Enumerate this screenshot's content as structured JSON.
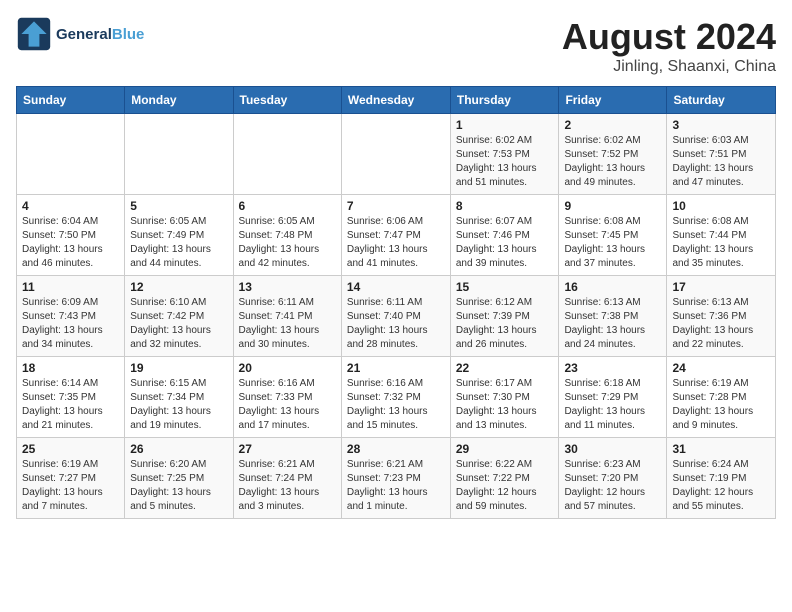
{
  "header": {
    "logo_line1": "General",
    "logo_line2": "Blue",
    "month_year": "August 2024",
    "location": "Jinling, Shaanxi, China"
  },
  "days_of_week": [
    "Sunday",
    "Monday",
    "Tuesday",
    "Wednesday",
    "Thursday",
    "Friday",
    "Saturday"
  ],
  "weeks": [
    [
      {
        "day": "",
        "info": ""
      },
      {
        "day": "",
        "info": ""
      },
      {
        "day": "",
        "info": ""
      },
      {
        "day": "",
        "info": ""
      },
      {
        "day": "1",
        "info": "Sunrise: 6:02 AM\nSunset: 7:53 PM\nDaylight: 13 hours\nand 51 minutes."
      },
      {
        "day": "2",
        "info": "Sunrise: 6:02 AM\nSunset: 7:52 PM\nDaylight: 13 hours\nand 49 minutes."
      },
      {
        "day": "3",
        "info": "Sunrise: 6:03 AM\nSunset: 7:51 PM\nDaylight: 13 hours\nand 47 minutes."
      }
    ],
    [
      {
        "day": "4",
        "info": "Sunrise: 6:04 AM\nSunset: 7:50 PM\nDaylight: 13 hours\nand 46 minutes."
      },
      {
        "day": "5",
        "info": "Sunrise: 6:05 AM\nSunset: 7:49 PM\nDaylight: 13 hours\nand 44 minutes."
      },
      {
        "day": "6",
        "info": "Sunrise: 6:05 AM\nSunset: 7:48 PM\nDaylight: 13 hours\nand 42 minutes."
      },
      {
        "day": "7",
        "info": "Sunrise: 6:06 AM\nSunset: 7:47 PM\nDaylight: 13 hours\nand 41 minutes."
      },
      {
        "day": "8",
        "info": "Sunrise: 6:07 AM\nSunset: 7:46 PM\nDaylight: 13 hours\nand 39 minutes."
      },
      {
        "day": "9",
        "info": "Sunrise: 6:08 AM\nSunset: 7:45 PM\nDaylight: 13 hours\nand 37 minutes."
      },
      {
        "day": "10",
        "info": "Sunrise: 6:08 AM\nSunset: 7:44 PM\nDaylight: 13 hours\nand 35 minutes."
      }
    ],
    [
      {
        "day": "11",
        "info": "Sunrise: 6:09 AM\nSunset: 7:43 PM\nDaylight: 13 hours\nand 34 minutes."
      },
      {
        "day": "12",
        "info": "Sunrise: 6:10 AM\nSunset: 7:42 PM\nDaylight: 13 hours\nand 32 minutes."
      },
      {
        "day": "13",
        "info": "Sunrise: 6:11 AM\nSunset: 7:41 PM\nDaylight: 13 hours\nand 30 minutes."
      },
      {
        "day": "14",
        "info": "Sunrise: 6:11 AM\nSunset: 7:40 PM\nDaylight: 13 hours\nand 28 minutes."
      },
      {
        "day": "15",
        "info": "Sunrise: 6:12 AM\nSunset: 7:39 PM\nDaylight: 13 hours\nand 26 minutes."
      },
      {
        "day": "16",
        "info": "Sunrise: 6:13 AM\nSunset: 7:38 PM\nDaylight: 13 hours\nand 24 minutes."
      },
      {
        "day": "17",
        "info": "Sunrise: 6:13 AM\nSunset: 7:36 PM\nDaylight: 13 hours\nand 22 minutes."
      }
    ],
    [
      {
        "day": "18",
        "info": "Sunrise: 6:14 AM\nSunset: 7:35 PM\nDaylight: 13 hours\nand 21 minutes."
      },
      {
        "day": "19",
        "info": "Sunrise: 6:15 AM\nSunset: 7:34 PM\nDaylight: 13 hours\nand 19 minutes."
      },
      {
        "day": "20",
        "info": "Sunrise: 6:16 AM\nSunset: 7:33 PM\nDaylight: 13 hours\nand 17 minutes."
      },
      {
        "day": "21",
        "info": "Sunrise: 6:16 AM\nSunset: 7:32 PM\nDaylight: 13 hours\nand 15 minutes."
      },
      {
        "day": "22",
        "info": "Sunrise: 6:17 AM\nSunset: 7:30 PM\nDaylight: 13 hours\nand 13 minutes."
      },
      {
        "day": "23",
        "info": "Sunrise: 6:18 AM\nSunset: 7:29 PM\nDaylight: 13 hours\nand 11 minutes."
      },
      {
        "day": "24",
        "info": "Sunrise: 6:19 AM\nSunset: 7:28 PM\nDaylight: 13 hours\nand 9 minutes."
      }
    ],
    [
      {
        "day": "25",
        "info": "Sunrise: 6:19 AM\nSunset: 7:27 PM\nDaylight: 13 hours\nand 7 minutes."
      },
      {
        "day": "26",
        "info": "Sunrise: 6:20 AM\nSunset: 7:25 PM\nDaylight: 13 hours\nand 5 minutes."
      },
      {
        "day": "27",
        "info": "Sunrise: 6:21 AM\nSunset: 7:24 PM\nDaylight: 13 hours\nand 3 minutes."
      },
      {
        "day": "28",
        "info": "Sunrise: 6:21 AM\nSunset: 7:23 PM\nDaylight: 13 hours\nand 1 minute."
      },
      {
        "day": "29",
        "info": "Sunrise: 6:22 AM\nSunset: 7:22 PM\nDaylight: 12 hours\nand 59 minutes."
      },
      {
        "day": "30",
        "info": "Sunrise: 6:23 AM\nSunset: 7:20 PM\nDaylight: 12 hours\nand 57 minutes."
      },
      {
        "day": "31",
        "info": "Sunrise: 6:24 AM\nSunset: 7:19 PM\nDaylight: 12 hours\nand 55 minutes."
      }
    ]
  ]
}
